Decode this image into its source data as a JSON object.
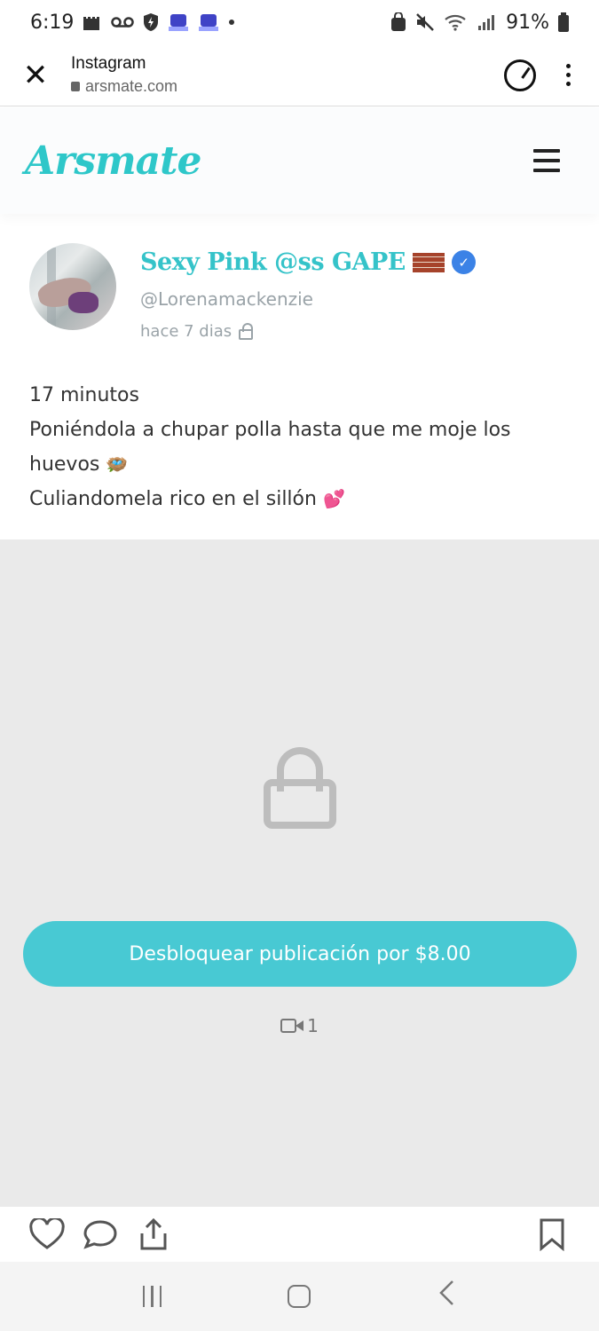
{
  "status_bar": {
    "time": "6:19",
    "battery": "91%"
  },
  "browser": {
    "title": "Instagram",
    "url": "arsmate.com"
  },
  "site": {
    "logo": "Arsmate"
  },
  "post": {
    "display_name": "Sexy Pink @ss GAPE",
    "handle": "@Lorenamackenzie",
    "timestamp": "hace 7 dias",
    "caption_lines": [
      "17 minutos",
      "Poniéndola a chupar polla hasta que me moje los",
      "huevos",
      "Culiandomela rico en el sillón"
    ],
    "unlock_label": "Desbloquear publicación por $8.00",
    "video_count": "1"
  },
  "colors": {
    "accent": "#48c9d3",
    "logo": "#2ec7c9",
    "verified": "#3b82e6"
  }
}
